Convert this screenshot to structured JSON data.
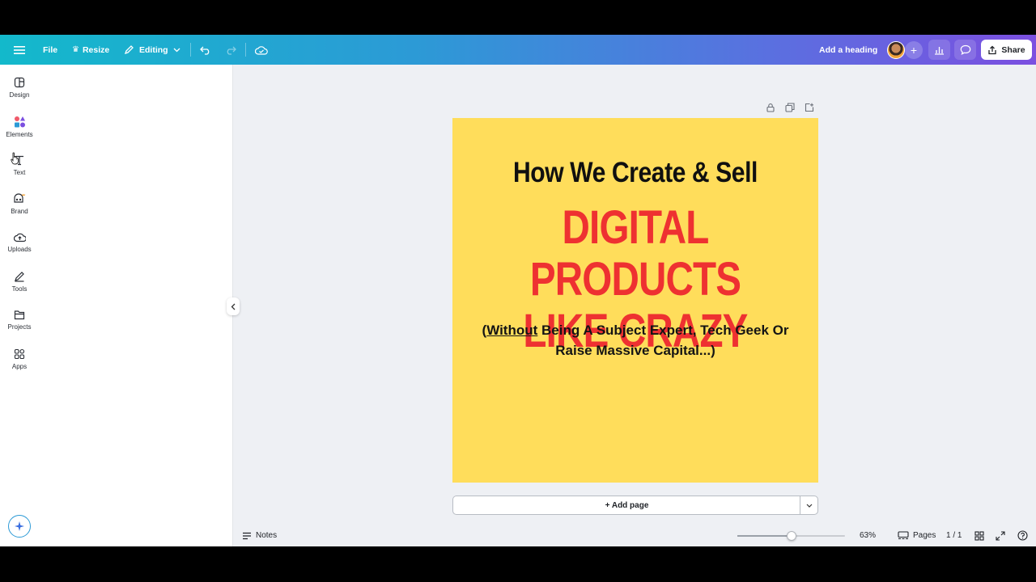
{
  "topbar": {
    "file_label": "File",
    "resize_label": "Resize",
    "editing_label": "Editing",
    "add_heading_label": "Add a heading",
    "share_label": "Share"
  },
  "rail": {
    "items": [
      {
        "label": "Design",
        "icon": "design-icon"
      },
      {
        "label": "Elements",
        "icon": "elements-icon"
      },
      {
        "label": "Text",
        "icon": "text-icon"
      },
      {
        "label": "Brand",
        "icon": "brand-icon"
      },
      {
        "label": "Uploads",
        "icon": "uploads-icon"
      },
      {
        "label": "Tools",
        "icon": "tools-icon"
      },
      {
        "label": "Projects",
        "icon": "projects-icon"
      },
      {
        "label": "Apps",
        "icon": "apps-icon"
      }
    ]
  },
  "design": {
    "headline": "How We Create & Sell",
    "highlight_line1": "DIGITAL PRODUCTS",
    "highlight_line2": "LIKE CRAZY",
    "sub_open": "(",
    "sub_underlined": "Without",
    "sub_rest": " Being A Subject Expert, Tech Geek Or Raise Massive Capital...)",
    "background_color": "#ffdd5b",
    "highlight_color": "#ee3131"
  },
  "canvas": {
    "add_page_label": "+ Add page"
  },
  "bottombar": {
    "notes_label": "Notes",
    "zoom_value": "63%",
    "zoom_fraction": 0.5,
    "pages_label": "Pages",
    "page_counter": "1 / 1"
  },
  "colors": {
    "topbar_start": "#13b9cb",
    "topbar_end": "#7b4fe0",
    "canvas_bg": "#eef0f4"
  }
}
